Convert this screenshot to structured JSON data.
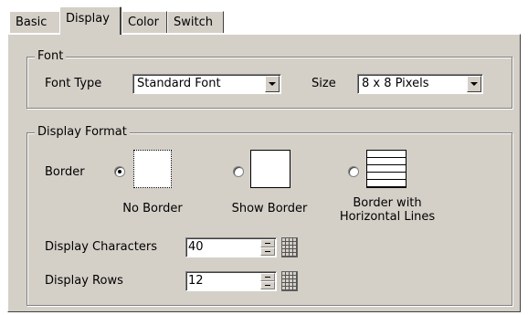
{
  "tabs": [
    {
      "label": "Basic"
    },
    {
      "label": "Display"
    },
    {
      "label": "Color"
    },
    {
      "label": "Switch"
    }
  ],
  "active_tab": "Display",
  "font_group": {
    "title": "Font",
    "font_type_label": "Font Type",
    "font_type_value": "Standard Font",
    "size_label": "Size",
    "size_value": "8 x 8 Pixels"
  },
  "format_group": {
    "title": "Display Format",
    "border_label": "Border",
    "border_options": [
      {
        "label": "No Border",
        "selected": true
      },
      {
        "label": "Show Border",
        "selected": false
      },
      {
        "label": "Border with Horizontal Lines",
        "line1": "Border with",
        "line2": "Horizontal Lines",
        "selected": false
      }
    ],
    "display_characters_label": "Display Characters",
    "display_characters_value": "40",
    "display_rows_label": "Display Rows",
    "display_rows_value": "12"
  }
}
